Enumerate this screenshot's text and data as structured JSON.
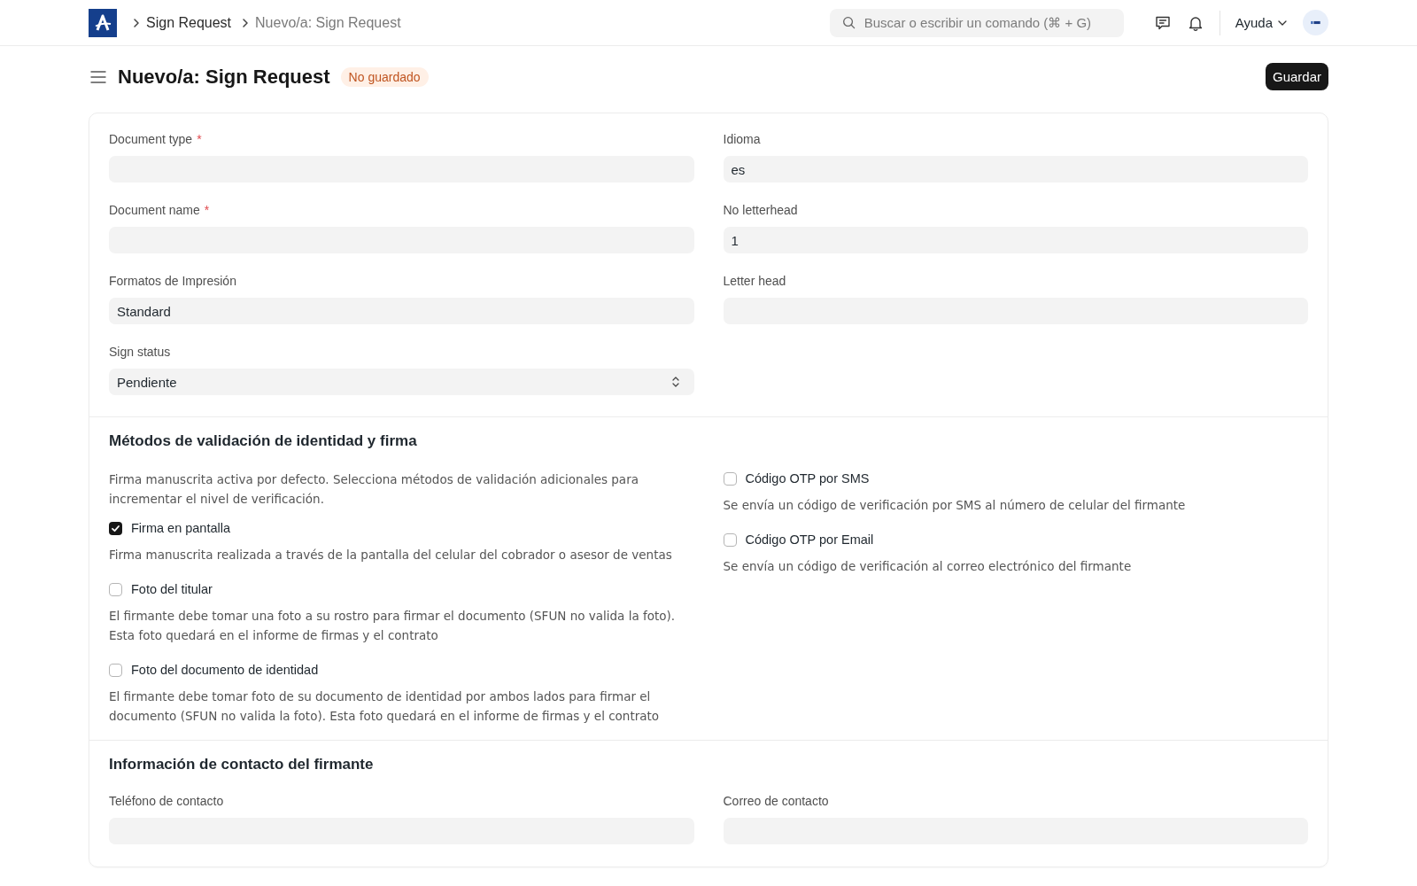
{
  "topbar": {
    "breadcrumbs": [
      {
        "label": "Sign Request",
        "current": false
      },
      {
        "label": "Nuevo/a: Sign Request",
        "current": true
      }
    ],
    "search": {
      "placeholder": "Buscar o escribir un comando (⌘ + G)"
    },
    "help_menu": {
      "label": "Ayuda"
    }
  },
  "page_header": {
    "title": "Nuevo/a: Sign Request",
    "status_badge": "No guardado",
    "save_button": "Guardar"
  },
  "sections": [
    {
      "columns": [
        {
          "items": [
            {
              "kind": "input",
              "label": "Document type",
              "required_mark": "*"
            },
            {
              "kind": "input",
              "label": "Document name",
              "required_mark": "*"
            },
            {
              "kind": "input",
              "label": "Formatos de Impresión",
              "value": "Standard"
            },
            {
              "kind": "select",
              "label": "Sign status",
              "value": "Pendiente"
            }
          ]
        },
        {
          "items": [
            {
              "kind": "input",
              "label": "Idioma",
              "value": "es"
            },
            {
              "kind": "input",
              "label": "No letterhead",
              "value": "1"
            },
            {
              "kind": "input",
              "label": "Letter head"
            }
          ]
        }
      ]
    },
    {
      "title": "Métodos de validación de identidad y firma",
      "columns": [
        {
          "items": [
            {
              "kind": "paragraph",
              "text": "Firma manuscrita activa por defecto. Selecciona métodos de validación adicionales para incrementar el nivel de verificación."
            },
            {
              "kind": "checkbox",
              "label": "Firma en pantalla",
              "checked": true,
              "description": "Firma manuscrita realizada a través de la pantalla del celular del cobrador o asesor de ventas"
            },
            {
              "kind": "checkbox",
              "label": "Foto del titular",
              "checked": false,
              "description": "El firmante debe tomar una foto a su rostro para firmar el documento (SFUN no valida la foto). Esta foto quedará en el informe de firmas y el contrato"
            },
            {
              "kind": "checkbox",
              "label": "Foto del documento de identidad",
              "checked": false,
              "description": "El firmante debe tomar foto de su documento de identidad por ambos lados para firmar el documento (SFUN no valida la foto). Esta foto quedará en el informe de firmas y el contrato"
            }
          ]
        },
        {
          "items": [
            {
              "kind": "checkbox",
              "label": "Código OTP por SMS",
              "checked": false,
              "description": "Se envía un código de verificación por SMS al número de celular del firmante"
            },
            {
              "kind": "checkbox",
              "label": "Código OTP por Email",
              "checked": false,
              "description": "Se envía un código de verificación al correo electrónico del firmante"
            }
          ]
        }
      ]
    },
    {
      "title": "Información de contacto del firmante",
      "columns": [
        {
          "items": [
            {
              "kind": "input",
              "label": "Teléfono de contacto"
            }
          ]
        },
        {
          "items": [
            {
              "kind": "input",
              "label": "Correo de contacto"
            }
          ]
        }
      ]
    }
  ]
}
